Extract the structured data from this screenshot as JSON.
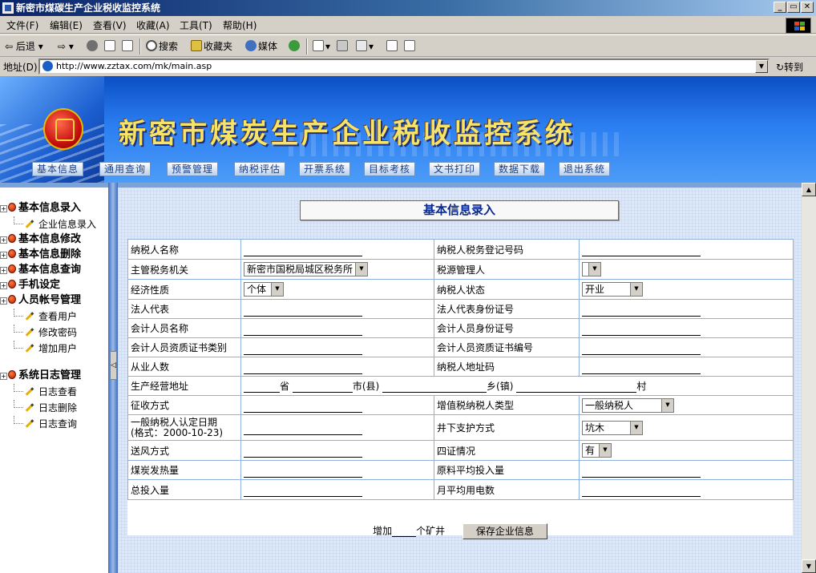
{
  "window": {
    "title": "新密市煤碳生产企业税收监控系统",
    "min": "_",
    "max": "▭",
    "close": "✕"
  },
  "menubar": [
    "文件(F)",
    "编辑(E)",
    "查看(V)",
    "收藏(A)",
    "工具(T)",
    "帮助(H)"
  ],
  "toolbar": {
    "back": "后退",
    "search": "搜索",
    "favorites": "收藏夹",
    "media": "媒体"
  },
  "address": {
    "label": "地址(D)",
    "url": "http://www.zztax.com/mk/main.asp",
    "go": "转到"
  },
  "banner": {
    "title": "新密市煤炭生产企业税收监控系统",
    "nav": [
      "基本信息",
      "通用查询",
      "预警管理",
      "纳税评估",
      "开票系统",
      "目标考核",
      "文书打印",
      "数据下载",
      "退出系统"
    ]
  },
  "sidebar": [
    {
      "label": "基本信息录入",
      "kind": "top"
    },
    {
      "label": "企业信息录入",
      "kind": "sub"
    },
    {
      "label": "基本信息修改",
      "kind": "top"
    },
    {
      "label": "基本信息删除",
      "kind": "top"
    },
    {
      "label": "基本信息查询",
      "kind": "top"
    },
    {
      "label": "手机设定",
      "kind": "top"
    },
    {
      "label": "人员帐号管理",
      "kind": "top"
    },
    {
      "label": "查看用户",
      "kind": "sub"
    },
    {
      "label": "修改密码",
      "kind": "sub"
    },
    {
      "label": "增加用户",
      "kind": "sub"
    },
    {
      "label": "系统日志管理",
      "kind": "top"
    },
    {
      "label": "日志查看",
      "kind": "sub"
    },
    {
      "label": "日志删除",
      "kind": "sub"
    },
    {
      "label": "日志查询",
      "kind": "sub"
    }
  ],
  "form": {
    "title": "基本信息录入",
    "rows": [
      {
        "l1": "纳税人名称",
        "l2": "纳税人税务登记号码"
      },
      {
        "l1": "主管税务机关",
        "s1": "新密市国税局城区税务所",
        "l2": "税源管理人",
        "s2": ""
      },
      {
        "l1": "经济性质",
        "s1": "个体",
        "l2": "纳税人状态",
        "s2": "开业"
      },
      {
        "l1": "法人代表",
        "l2": "法人代表身份证号"
      },
      {
        "l1": "会计人员名称",
        "l2": "会计人员身份证号"
      },
      {
        "l1": "会计人员资质证书类别",
        "l2": "会计人员资质证书编号"
      },
      {
        "l1": "从业人数",
        "l2": "纳税人地址码"
      },
      {
        "l1": "生产经营地址"
      },
      {
        "l1": "征收方式",
        "l2": "增值税纳税人类型",
        "s2": "一般纳税人"
      },
      {
        "l1": "一般纳税人认定日期",
        "l1b": "(格式：2000-10-23)",
        "l2": "井下支护方式",
        "s2": "坑木"
      },
      {
        "l1": "送风方式",
        "l2": "四证情况",
        "s2": "有"
      },
      {
        "l1": "煤炭发热量",
        "l2": "原料平均投入量"
      },
      {
        "l1": "总投入量",
        "l2": "月平均用电数"
      }
    ],
    "address_units": [
      "省",
      "市(县)",
      "乡(镇)",
      "村"
    ],
    "add_prefix": "增加",
    "add_suffix": "个矿井",
    "save": "保存企业信息"
  }
}
